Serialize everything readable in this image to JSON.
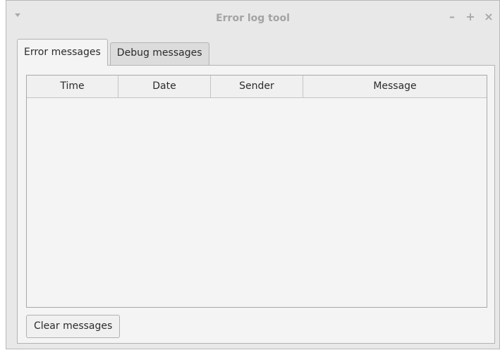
{
  "window": {
    "title": "Error log tool",
    "controls": {
      "minimize": "–",
      "maximize": "+",
      "close": "×"
    }
  },
  "tabs": [
    {
      "label": "Error messages",
      "active": true
    },
    {
      "label": "Debug messages",
      "active": false
    }
  ],
  "table": {
    "columns": [
      "Time",
      "Date",
      "Sender",
      "Message"
    ],
    "rows": []
  },
  "actions": {
    "clear_label": "Clear messages"
  }
}
